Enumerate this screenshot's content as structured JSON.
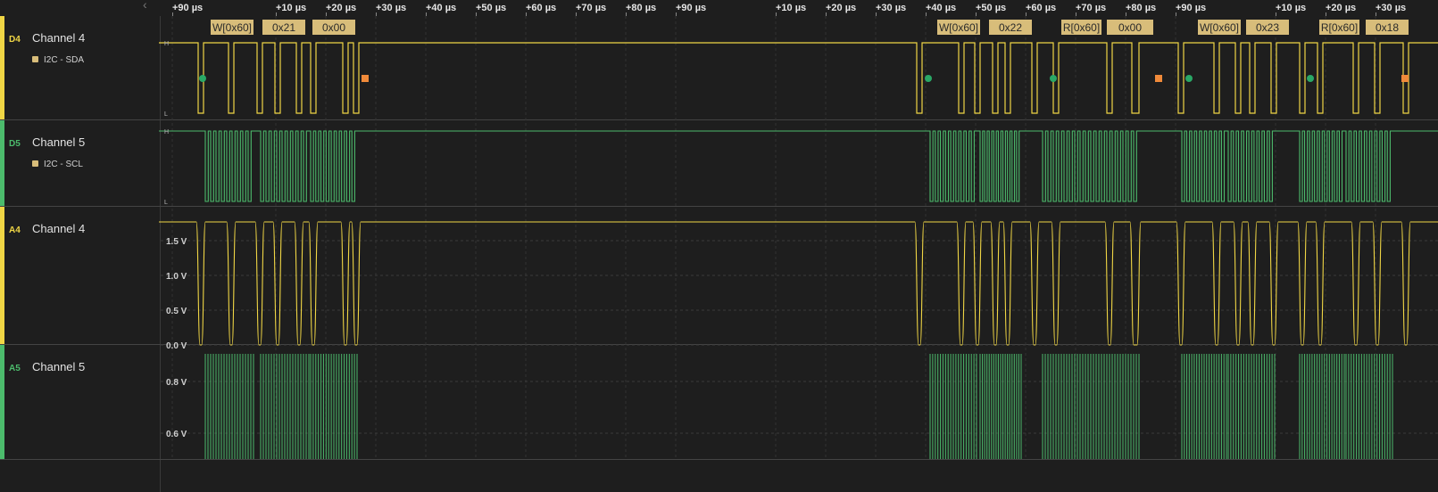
{
  "ruler": {
    "ticks": [
      "+90 µs",
      "+10 µs",
      "+20 µs",
      "+30 µs",
      "+40 µs",
      "+50 µs",
      "+60 µs",
      "+70 µs",
      "+80 µs",
      "+90 µs",
      "+10 µs",
      "+20 µs",
      "+30 µs",
      "+40 µs",
      "+50 µs",
      "+60 µs",
      "+70 µs",
      "+80 µs",
      "+90 µs",
      "+10 µs",
      "+20 µs",
      "+30 µs"
    ]
  },
  "channels": [
    {
      "id": "D4",
      "name": "Channel 4",
      "analyzer": "I2C - SDA",
      "color": "#f0d645"
    },
    {
      "id": "D5",
      "name": "Channel 5",
      "analyzer": "I2C - SCL",
      "color": "#4cbb6c"
    },
    {
      "id": "A4",
      "name": "Channel 4",
      "color": "#f0d645"
    },
    {
      "id": "A5",
      "name": "Channel 5",
      "color": "#4cbb6c"
    }
  ],
  "level_labels": {
    "high": "H",
    "low": "L"
  },
  "analog_axes": {
    "a4": [
      "1.5 V",
      "1.0 V",
      "0.5 V",
      "0.0 V"
    ],
    "a5": [
      "0.8 V",
      "0.6 V"
    ]
  },
  "decoded": [
    "W[0x60]",
    "0x21",
    "0x00",
    "W[0x60]",
    "0x22",
    "R[0x60]",
    "0x00",
    "W[0x60]",
    "0x23",
    "R[0x60]",
    "0x18"
  ],
  "colors": {
    "sda": "#f0d645",
    "scl": "#4cbb6c",
    "annotation": "#d8bd7a",
    "start": "#2aa866",
    "stop": "#f08a3a"
  }
}
